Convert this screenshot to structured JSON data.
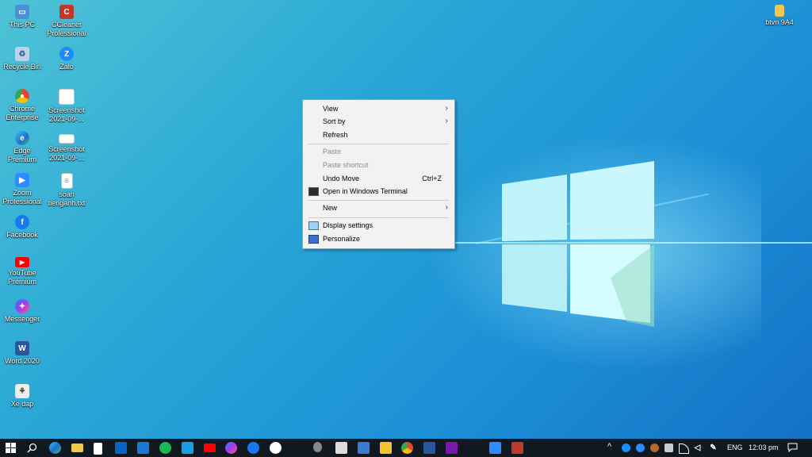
{
  "desktop_icons": [
    {
      "label": "This PC",
      "color": "#4a90d9",
      "glyph": "▭"
    },
    {
      "label": "CCleaner Professional",
      "color": "#c0392b",
      "glyph": "C"
    },
    {
      "label": "Recycle Bin",
      "color": "#bcd3e6",
      "glyph": "♻"
    },
    {
      "label": "Zalo",
      "color": "#1a8cff",
      "glyph": "Z"
    },
    {
      "label": "Chrome Enterprise",
      "color": "#e8453c",
      "glyph": "●"
    },
    {
      "label": "Screenshot 2021-09-...",
      "color": "#ffffff",
      "glyph": ""
    },
    {
      "label": "Edge Premium",
      "color": "#1a9fd8",
      "glyph": "e"
    },
    {
      "label": "Screenshot 2021-09-...",
      "color": "#ffffff",
      "glyph": ""
    },
    {
      "label": "Zoom Professional",
      "color": "#2d8cff",
      "glyph": "▶"
    },
    {
      "label": "soan tienganh.txt",
      "color": "#ffffff",
      "glyph": "≡"
    },
    {
      "label": "Facebook",
      "color": "#1877f2",
      "glyph": "f"
    },
    {
      "label": "YouTube Premium",
      "color": "#ff0000",
      "glyph": "▶"
    },
    {
      "label": "Messenger",
      "color": "#a34dff",
      "glyph": "✦"
    },
    {
      "label": "Word 2020",
      "color": "#2b579a",
      "glyph": "W"
    },
    {
      "label": "Xe dap",
      "color": "#eeeeee",
      "glyph": "⚘"
    },
    {
      "label": "btvn 9A4",
      "color": "#f2c94c",
      "glyph": ""
    }
  ],
  "context_menu": {
    "view": "View",
    "sort_by": "Sort by",
    "refresh": "Refresh",
    "paste": "Paste",
    "paste_shortcut": "Paste shortcut",
    "undo_move": "Undo Move",
    "undo_shortcut": "Ctrl+Z",
    "open_terminal": "Open in Windows Terminal",
    "new": "New",
    "display_settings": "Display settings",
    "personalize": "Personalize",
    "submenu_arrow": "›"
  },
  "taskbar": {
    "language": "ENG",
    "time": "12:03 pm"
  }
}
